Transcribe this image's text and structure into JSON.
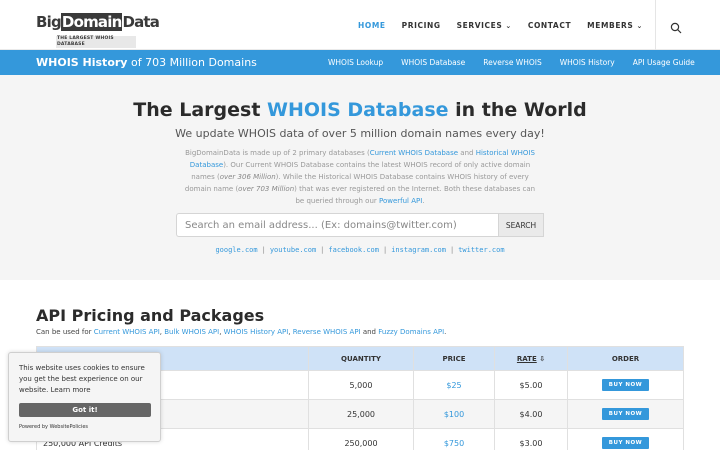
{
  "logo": {
    "main_left": "Big",
    "main_mid": "Domain",
    "main_right": "Data",
    "tagline": "THE LARGEST WHOIS DATABASE"
  },
  "nav": {
    "items": [
      {
        "label": "HOME",
        "active": true,
        "dropdown": false
      },
      {
        "label": "PRICING",
        "active": false,
        "dropdown": false
      },
      {
        "label": "SERVICES",
        "active": false,
        "dropdown": true
      },
      {
        "label": "CONTACT",
        "active": false,
        "dropdown": false
      },
      {
        "label": "MEMBERS",
        "active": false,
        "dropdown": true
      }
    ],
    "chevron": "⌄",
    "search_icon": "search-icon"
  },
  "bluebar": {
    "headline_bold": "WHOIS History",
    "headline_rest": " of 703 Million Domains",
    "links": [
      "WHOIS Lookup",
      "WHOIS Database",
      "Reverse WHOIS",
      "WHOIS History",
      "API Usage Guide"
    ]
  },
  "hero": {
    "title_pre": "The Largest ",
    "title_accent": "WHOIS Database",
    "title_post": " in the World",
    "subtitle": "We update WHOIS data of over 5 million domain names every day!",
    "desc": {
      "p1": "BigDomainData is made up of 2 primary databases (",
      "l1": "Current WHOIS Database",
      "p2": " and ",
      "l2": "Historical WHOIS Database",
      "p3": "). Our Current WHOIS Database contains the latest WHOIS record of only active domain names (",
      "i1": "over 306 Million",
      "p4": "). While the Historical WHOIS Database contains WHOIS history of every domain name (",
      "i2": "over 703 Million",
      "p5": ") that was ever registered on the Internet. Both these databases can be queried through our ",
      "l3": "Powerful API",
      "p6": "."
    },
    "search_placeholder": "Search an email address... (Ex: domains@twitter.com)",
    "search_button": "SEARCH",
    "example_links": [
      "google.com",
      "youtube.com",
      "facebook.com",
      "instagram.com",
      "twitter.com"
    ],
    "separator": "|"
  },
  "pricing": {
    "title": "API Pricing and Packages",
    "desc_pre": "Can be used for ",
    "links": [
      "Current WHOIS API",
      "Bulk WHOIS API",
      "WHOIS History API",
      "Reverse WHOIS API",
      "Fuzzy Domains API"
    ],
    "desc_and": " and ",
    "desc_end": ".",
    "columns": {
      "package": "PACKAGE",
      "quantity": "QUANTITY",
      "price": "PRICE",
      "rate": "RATE",
      "rate_sort": "⇩",
      "order": "ORDER"
    },
    "rows": [
      {
        "package": "",
        "quantity": "5,000",
        "price": "$25",
        "rate": "$5.00",
        "order": "BUY NOW"
      },
      {
        "package": "",
        "quantity": "25,000",
        "price": "$100",
        "rate": "$4.00",
        "order": "BUY NOW"
      },
      {
        "package": "250,000 API Credits",
        "quantity": "250,000",
        "price": "$750",
        "rate": "$3.00",
        "order": "BUY NOW"
      }
    ]
  },
  "cookie": {
    "text": "This website uses cookies to ensure you get the best experience on our website. ",
    "learn_more": "Learn more",
    "button": "Got it!",
    "powered": "Powered by WebsitePolicies"
  },
  "colors": {
    "accent": "#3498db",
    "header_row": "#cfe2f7",
    "hero_bg": "#f5f5f5"
  }
}
